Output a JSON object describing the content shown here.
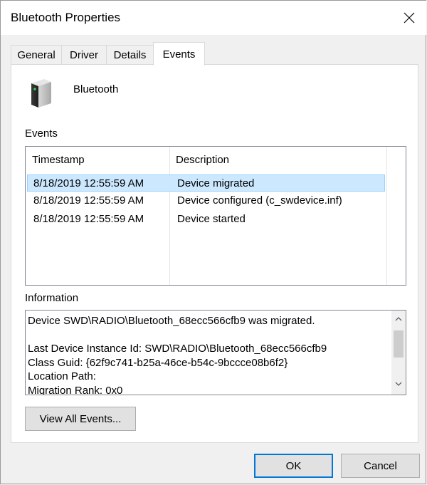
{
  "window": {
    "title": "Bluetooth Properties"
  },
  "tabs": [
    {
      "label": "General"
    },
    {
      "label": "Driver"
    },
    {
      "label": "Details"
    },
    {
      "label": "Events"
    }
  ],
  "device": {
    "name": "Bluetooth",
    "icon": "bluetooth-device-icon"
  },
  "events": {
    "label": "Events",
    "columns": [
      "Timestamp",
      "Description"
    ],
    "rows": [
      {
        "timestamp": "8/18/2019 12:55:59 AM",
        "description": "Device migrated"
      },
      {
        "timestamp": "8/18/2019 12:55:59 AM",
        "description": "Device configured (c_swdevice.inf)"
      },
      {
        "timestamp": "8/18/2019 12:55:59 AM",
        "description": "Device started"
      }
    ],
    "selected_row": 0
  },
  "information": {
    "label": "Information",
    "text": "Device SWD\\RADIO\\Bluetooth_68ecc566cfb9 was migrated.\n\nLast Device Instance Id: SWD\\RADIO\\Bluetooth_68ecc566cfb9\nClass Guid: {62f9c741-b25a-46ce-b54c-9bccce08b6f2}\nLocation Path:\nMigration Rank: 0x0"
  },
  "buttons": {
    "view_all": "View All Events...",
    "ok": "OK",
    "cancel": "Cancel"
  },
  "colors": {
    "selection": "#cce8ff",
    "selection_border": "#99d1ff",
    "default_button_border": "#0078d7"
  }
}
